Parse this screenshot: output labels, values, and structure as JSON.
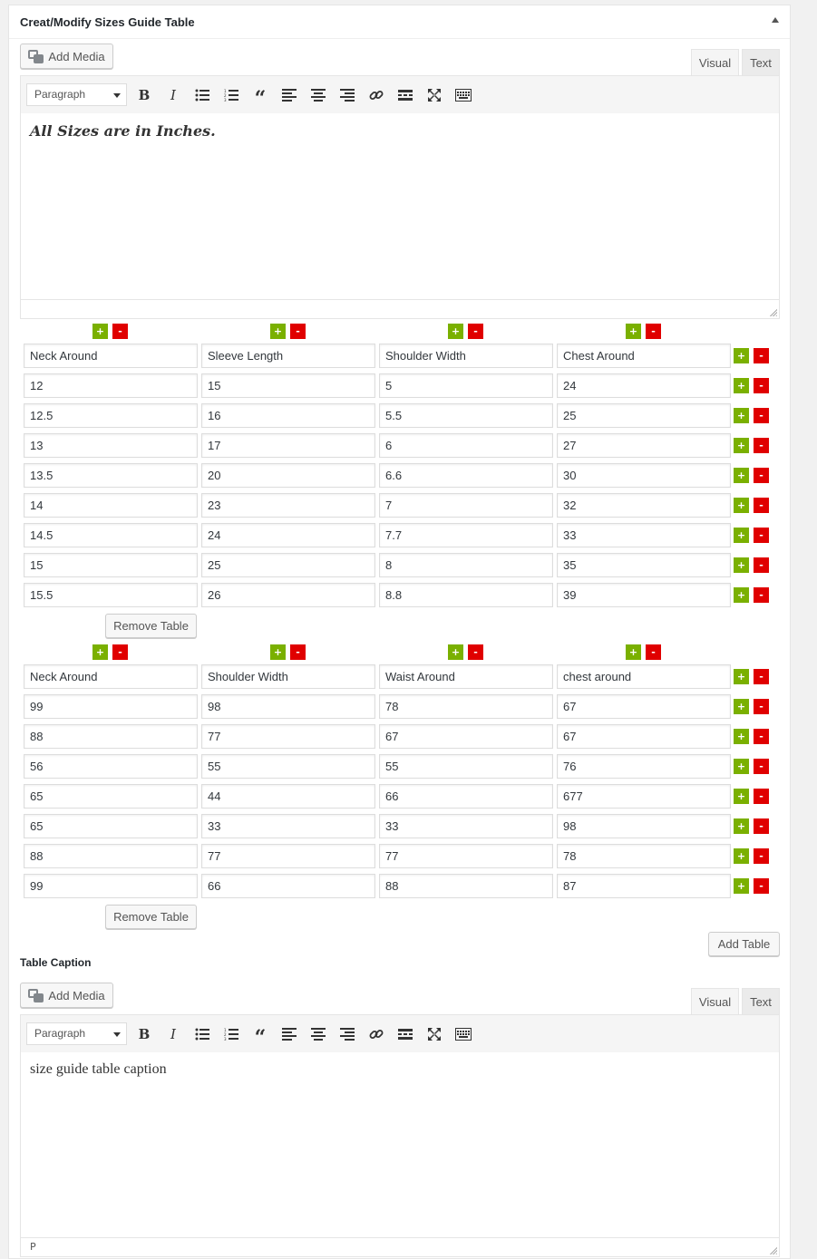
{
  "panel": {
    "title": "Creat/Modify Sizes Guide Table"
  },
  "editor1": {
    "add_media": "Add Media",
    "tab_visual": "Visual",
    "tab_text": "Text",
    "format_select": "Paragraph",
    "content": "All Sizes are in Inches."
  },
  "tables": [
    {
      "headers": [
        "Neck Around",
        "Sleeve Length",
        "Shoulder Width",
        "Chest Around"
      ],
      "rows": [
        [
          "12",
          "15",
          "5",
          "24"
        ],
        [
          "12.5",
          "16",
          "5.5",
          "25"
        ],
        [
          "13",
          "17",
          "6",
          "27"
        ],
        [
          "13.5",
          "20",
          "6.6",
          "30"
        ],
        [
          "14",
          "23",
          "7",
          "32"
        ],
        [
          "14.5",
          "24",
          "7.7",
          "33"
        ],
        [
          "15",
          "25",
          "8",
          "35"
        ],
        [
          "15.5",
          "26",
          "8.8",
          "39"
        ]
      ],
      "remove_label": "Remove Table"
    },
    {
      "headers": [
        "Neck Around",
        "Shoulder Width",
        "Waist Around",
        "chest around"
      ],
      "rows": [
        [
          "99",
          "98",
          "78",
          "67"
        ],
        [
          "88",
          "77",
          "67",
          "67"
        ],
        [
          "56",
          "55",
          "55",
          "76"
        ],
        [
          "65",
          "44",
          "66",
          "677"
        ],
        [
          "65",
          "33",
          "33",
          "98"
        ],
        [
          "88",
          "77",
          "77",
          "78"
        ],
        [
          "99",
          "66",
          "88",
          "87"
        ]
      ],
      "remove_label": "Remove Table"
    }
  ],
  "add_table": "Add Table",
  "caption_section": {
    "label": "Table Caption"
  },
  "editor2": {
    "add_media": "Add Media",
    "tab_visual": "Visual",
    "tab_text": "Text",
    "format_select": "Paragraph",
    "content": "size guide table caption",
    "status_path": "P"
  },
  "controls": {
    "plus": "+",
    "minus": "-"
  },
  "toolbar_icons": [
    "bold-icon",
    "italic-icon",
    "bullet-list-icon",
    "numbered-list-icon",
    "blockquote-icon",
    "align-left-icon",
    "align-center-icon",
    "align-right-icon",
    "link-icon",
    "read-more-icon",
    "fullscreen-icon",
    "toolbar-toggle-icon"
  ],
  "colors": {
    "plus": "#7ab000",
    "minus": "#e00000",
    "panel_bg": "#ffffff",
    "page_bg": "#f1f1f1"
  }
}
